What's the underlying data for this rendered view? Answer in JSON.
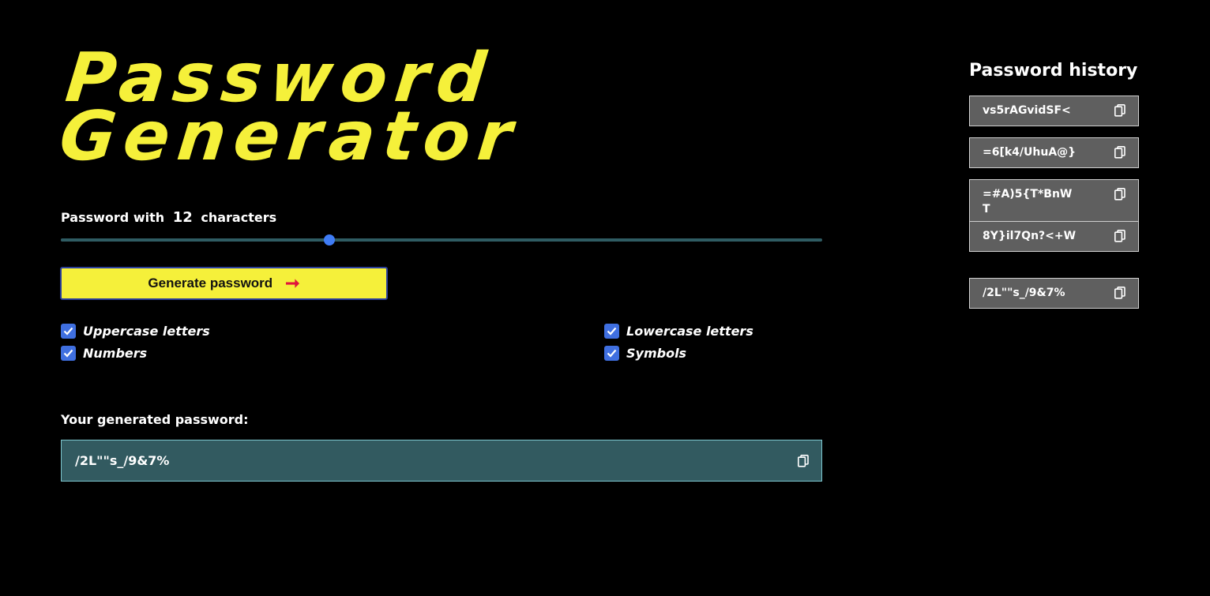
{
  "app": {
    "title_line1": "Password",
    "title_line2": "Generator",
    "accent_color": "#f5f03a"
  },
  "length": {
    "label_prefix": "Password with",
    "value": "12",
    "label_suffix": "characters",
    "slider_fraction": 0.353
  },
  "generate_button": {
    "label": "Generate password",
    "icon": "arrow-right-icon"
  },
  "options": [
    {
      "label": "Uppercase letters",
      "checked": true
    },
    {
      "label": "Lowercase letters",
      "checked": true
    },
    {
      "label": "Numbers",
      "checked": true
    },
    {
      "label": "Symbols",
      "checked": true
    }
  ],
  "output": {
    "label": "Your generated password:",
    "value": "/2L\"\"s_/9&7%",
    "icon": "copy-icon"
  },
  "history": {
    "title": "Password history",
    "items": [
      "vs5rAGvidSF<",
      "=6[k4/UhuA@}",
      "=#A)5{T*BnWT",
      "8Y}il7Qn?<+W",
      "/2L\"\"s_/9&7%"
    ]
  }
}
